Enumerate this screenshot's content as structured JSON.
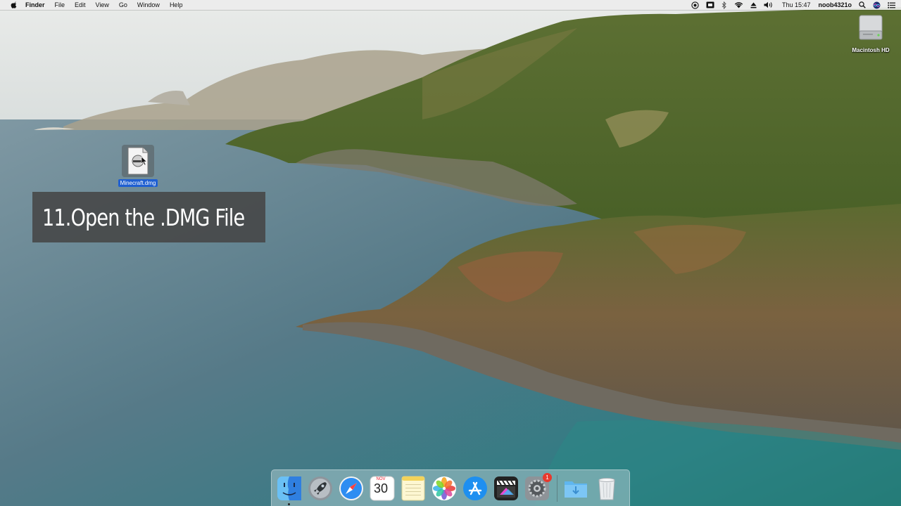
{
  "menubar": {
    "apple_icon": "apple-icon",
    "app_name": "Finder",
    "menus": [
      "File",
      "Edit",
      "View",
      "Go",
      "Window",
      "Help"
    ],
    "status_icons": [
      "screen-recorder-icon",
      "display-icon",
      "bluetooth-icon",
      "wifi-icon",
      "eject-icon",
      "volume-icon"
    ],
    "clock": "Thu 15:47",
    "user": "noob4321o",
    "right_icons": [
      "spotlight-icon",
      "siri-icon",
      "notification-center-icon"
    ]
  },
  "desktop": {
    "hd_label": "Macintosh HD",
    "dmg_label": "Minecraft.dmg"
  },
  "caption": {
    "text": "11.Open the .DMG File"
  },
  "dock": {
    "items": [
      "Finder",
      "Launchpad",
      "Safari",
      "Calendar",
      "Notes",
      "Photos",
      "App Store",
      "Final Cut Pro",
      "System Preferences",
      "Downloads",
      "Trash"
    ],
    "calendar_month": "NOV",
    "calendar_day": "30",
    "prefs_badge": "1"
  },
  "colors": {
    "selection": "#1f5fd1",
    "badge": "#e8392d"
  }
}
